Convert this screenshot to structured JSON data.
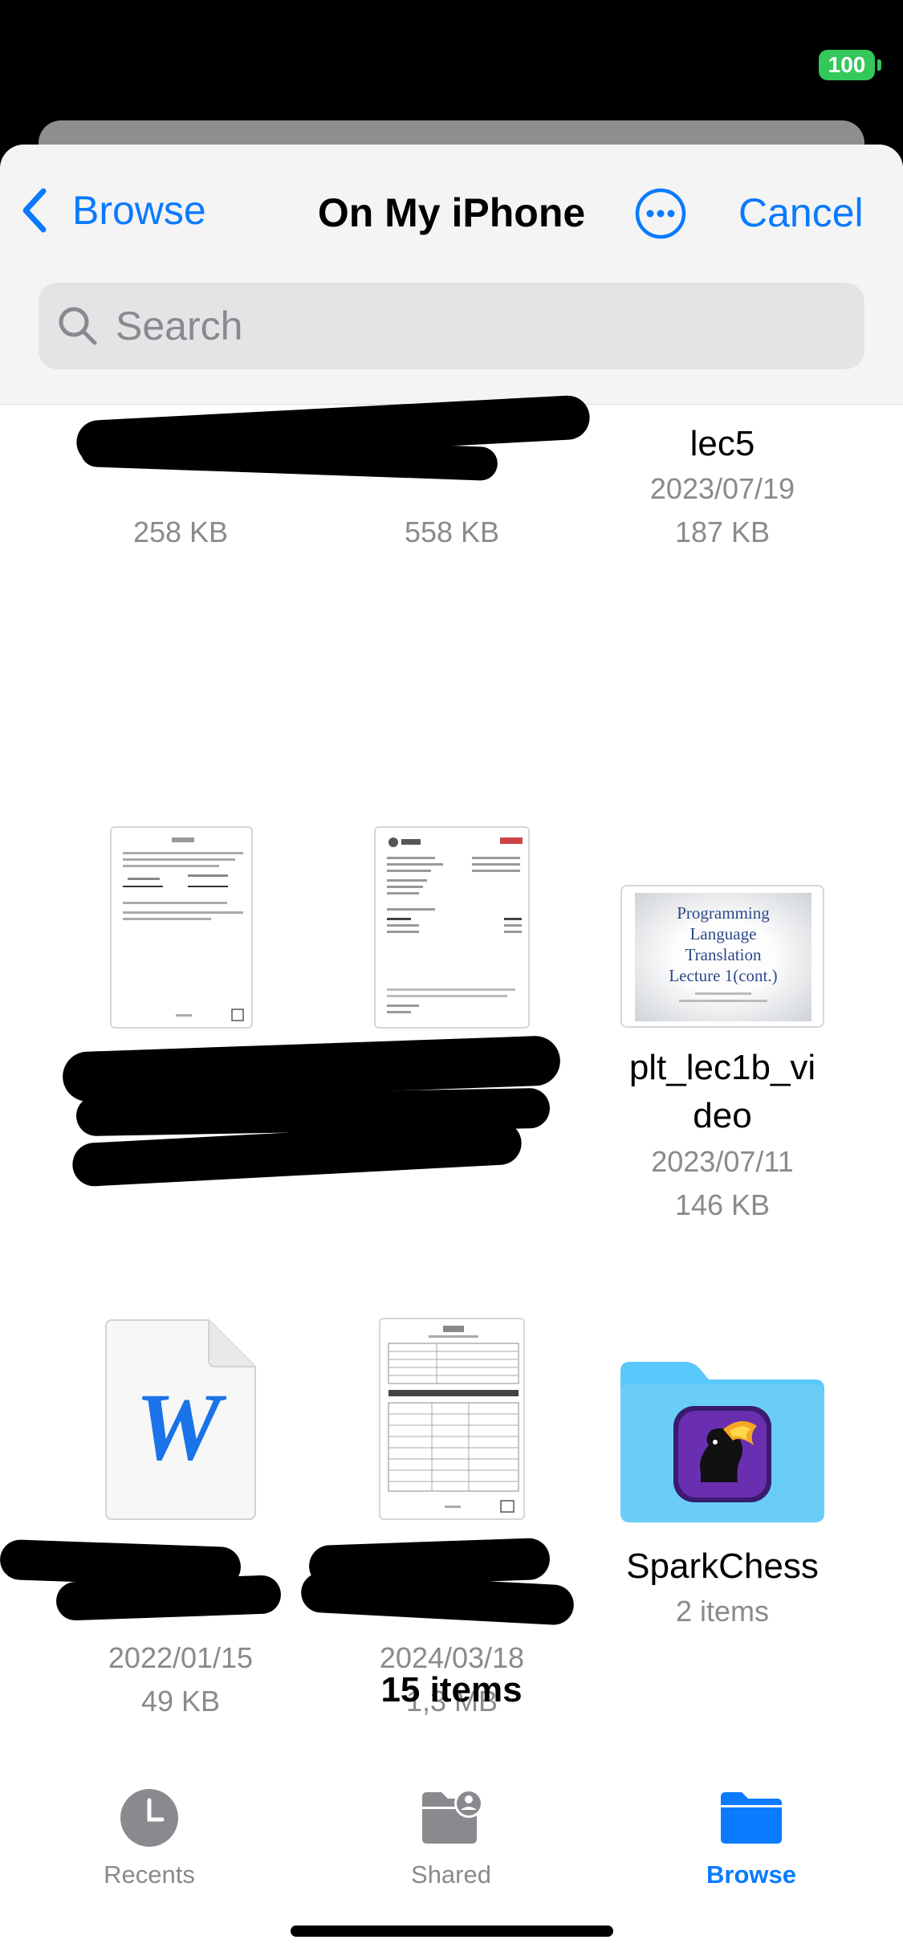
{
  "status_bar": {
    "battery": "100"
  },
  "nav": {
    "back_label": "Browse",
    "title": "On My iPhone",
    "cancel_label": "Cancel"
  },
  "search": {
    "placeholder": "Search"
  },
  "files": [
    {
      "name": "",
      "date": "",
      "size": "258 KB"
    },
    {
      "name": "",
      "date": "",
      "size": "558 KB"
    },
    {
      "name": "lec5",
      "date": "2023/07/19",
      "size": "187 KB"
    },
    {
      "name": "",
      "date": "",
      "size": ""
    },
    {
      "name": "",
      "date": "",
      "size": ""
    },
    {
      "name": "plt_lec1b_video",
      "date": "2023/07/11",
      "size": "146 KB",
      "thumbnail_text": [
        "Programming",
        "Language",
        "Translation",
        "Lecture 1(cont.)"
      ]
    },
    {
      "name": "",
      "date": "2022/01/15",
      "size": "49 KB"
    },
    {
      "name": "",
      "date": "2024/03/18",
      "size": "1,3 MB"
    },
    {
      "name": "SparkChess",
      "date": "",
      "size": "2 items"
    }
  ],
  "item_count": "15 items",
  "tabs": [
    {
      "label": "Recents",
      "icon": "clock-icon",
      "active": false
    },
    {
      "label": "Shared",
      "icon": "shared-folder-icon",
      "active": false
    },
    {
      "label": "Browse",
      "icon": "folder-icon",
      "active": true
    }
  ],
  "colors": {
    "accent": "#0a7aff",
    "inactive": "#8a8a8e",
    "battery": "#34c759",
    "folder": "#5ac8fa"
  }
}
